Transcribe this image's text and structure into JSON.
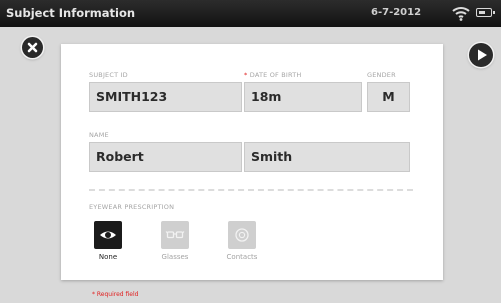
{
  "titlebar": {
    "title": "Subject Information",
    "date": "6-7-2012"
  },
  "form": {
    "subject_id_label": "SUBJECT ID",
    "subject_id_value": "SMITH123",
    "dob_required_mark": "*",
    "dob_label": "DATE OF BIRTH",
    "dob_value": "18m",
    "gender_label": "GENDER",
    "gender_value": "M",
    "name_label": "NAME",
    "first_name_value": "Robert",
    "last_name_value": "Smith",
    "eyewear_label": "EYEWEAR PRESCRIPTION",
    "eyewear_options": [
      {
        "label": "None",
        "icon": "eye-icon",
        "selected": true
      },
      {
        "label": "Glasses",
        "icon": "glasses-icon",
        "selected": false
      },
      {
        "label": "Contacts",
        "icon": "contact-lens-icon",
        "selected": false
      }
    ]
  },
  "footer": {
    "required_note": "* Required field"
  },
  "colors": {
    "selected_bg": "#1b1b1b",
    "required_red": "#e02020"
  }
}
